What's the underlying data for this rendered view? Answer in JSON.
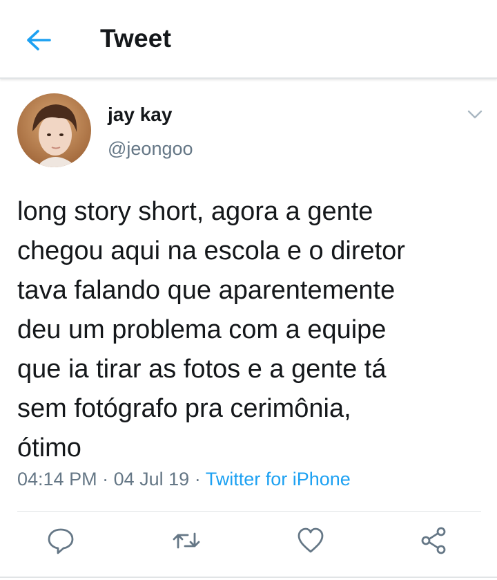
{
  "header": {
    "title": "Tweet",
    "back_icon": "arrow-left-icon",
    "accent_color": "#1da1f2"
  },
  "tweet": {
    "author": {
      "display_name": "jay kay",
      "handle": "@jeongoo",
      "avatar_icon": "user-avatar"
    },
    "text": "long story short, agora a gente\nchegou aqui na escola e o diretor\ntava falando que aparentemente\ndeu um problema com a equipe\nque ia tirar as fotos e a gente tá\nsem fotógrafo pra cerimônia,\nótimo",
    "time": "04:14 PM",
    "separator": "·",
    "date": "04 Jul 19",
    "source": "Twitter for iPhone",
    "menu_icon": "chevron-down-icon"
  },
  "actions": [
    {
      "name": "reply",
      "icon": "reply-icon"
    },
    {
      "name": "retweet",
      "icon": "retweet-icon"
    },
    {
      "name": "like",
      "icon": "heart-icon"
    },
    {
      "name": "share",
      "icon": "share-icon"
    }
  ],
  "colors": {
    "text": "#14171a",
    "secondary": "#657786",
    "link": "#1da1f2",
    "divider": "#e1e4e6"
  }
}
